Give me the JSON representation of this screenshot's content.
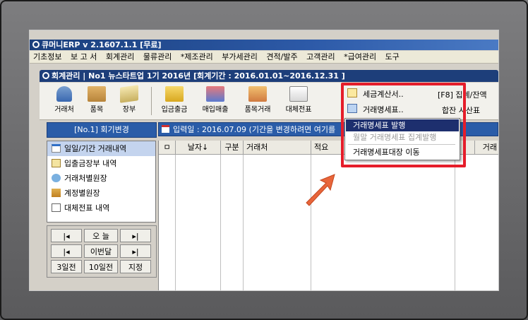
{
  "title": "큐머니ERP  v 2.1607.1.1 [무료]",
  "menu": [
    "기초정보",
    "보 고 서",
    "회계관리",
    "물류관리",
    "*제조관리",
    "부가세관리",
    "견적/발주",
    "고객관리",
    "*급여관리",
    "도구"
  ],
  "subtitle": "회계관리 | No1 뉴스타트업 1기 2016년 [회계기간 : 2016.01.01~2016.12.31 ]",
  "toolbar": {
    "buttons": [
      "거래처",
      "품목",
      "장부",
      "입금출금",
      "매입매출",
      "품목거래",
      "대체전표"
    ],
    "right_items": [
      "세금계산서..",
      "거래명세표.."
    ],
    "f8": "[F8] 집계/잔액",
    "trial": "합잔 시산표"
  },
  "left": {
    "header": "[No.1] 회기변경",
    "items": [
      "일일/기간 거래내역",
      "입출금장부 내역",
      "거래처별원장",
      "계정별원장",
      "대체전표 내역"
    ],
    "nav": {
      "today": "오 늘",
      "this_month": "이번달",
      "d3": "3일전",
      "d10": "10일전",
      "specify": "지정",
      "prev": "|◂",
      "next": "▸|"
    }
  },
  "main": {
    "header": "입력일 : 2016.07.09  (기간을 변경하려면 여기를",
    "columns": [
      "ㅁ",
      "날자↓",
      "구분",
      "거래처",
      "적요",
      "",
      "",
      "거래"
    ]
  },
  "dropdown": {
    "items": [
      "거래명세표 발행",
      "월말 거래명세표 집계발행",
      "거래명세표대장 이동"
    ]
  },
  "colors": {
    "highlight_box": "#e51d2a",
    "arrow": "#e8653a",
    "title_bar": "#1d3e7a"
  }
}
